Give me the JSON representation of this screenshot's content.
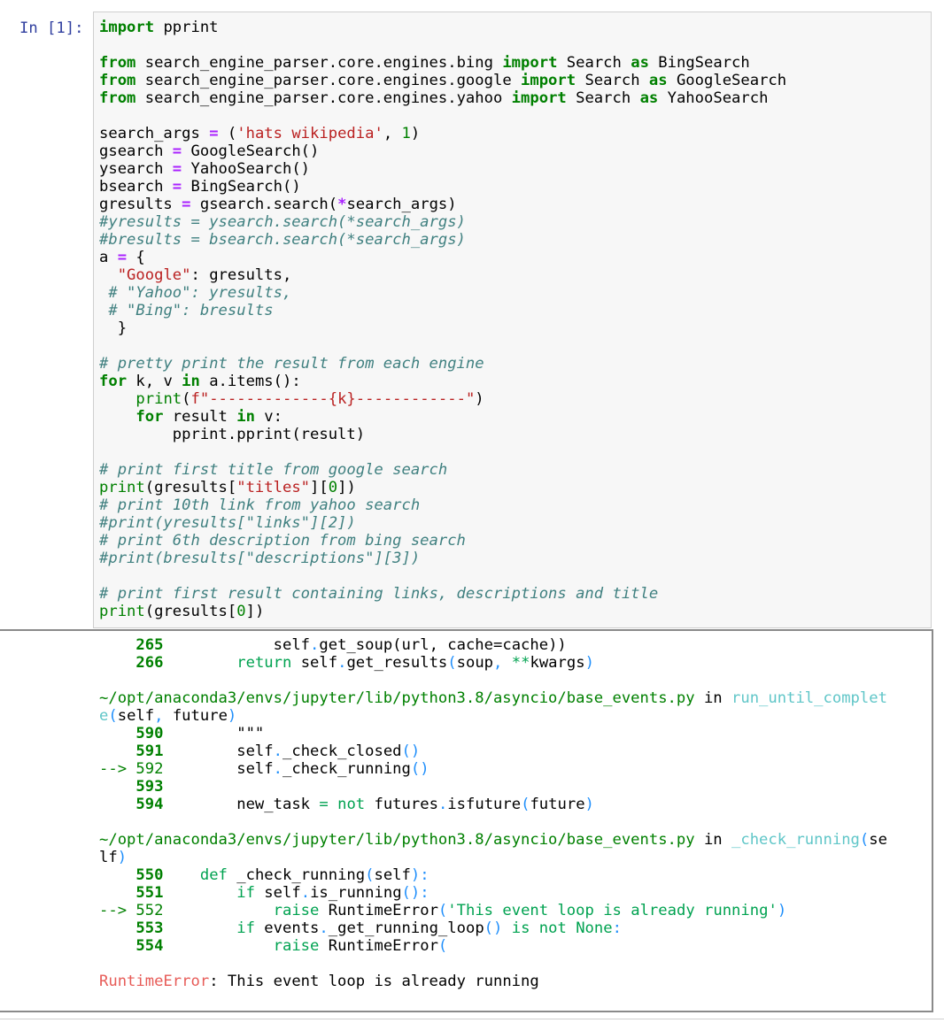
{
  "cell": {
    "prompt": "In [1]:",
    "code": [
      [
        [
          "import",
          "kw"
        ],
        [
          " pprint",
          ""
        ]
      ],
      [],
      [
        [
          "from",
          "kw"
        ],
        [
          " search_engine_parser.core.engines.bing ",
          ""
        ],
        [
          "import",
          "kw"
        ],
        [
          " Search ",
          ""
        ],
        [
          "as",
          "kw"
        ],
        [
          " BingSearch",
          ""
        ]
      ],
      [
        [
          "from",
          "kw"
        ],
        [
          " search_engine_parser.core.engines.google ",
          ""
        ],
        [
          "import",
          "kw"
        ],
        [
          " Search ",
          ""
        ],
        [
          "as",
          "kw"
        ],
        [
          " GoogleSearch",
          ""
        ]
      ],
      [
        [
          "from",
          "kw"
        ],
        [
          " search_engine_parser.core.engines.yahoo ",
          ""
        ],
        [
          "import",
          "kw"
        ],
        [
          " Search ",
          ""
        ],
        [
          "as",
          "kw"
        ],
        [
          " YahooSearch",
          ""
        ]
      ],
      [],
      [
        [
          "search_args ",
          ""
        ],
        [
          "=",
          "op"
        ],
        [
          " (",
          ""
        ],
        [
          "'hats wikipedia'",
          "str"
        ],
        [
          ", ",
          ""
        ],
        [
          "1",
          "num"
        ],
        [
          ")",
          ""
        ]
      ],
      [
        [
          "gsearch ",
          ""
        ],
        [
          "=",
          "op"
        ],
        [
          " GoogleSearch()",
          ""
        ]
      ],
      [
        [
          "ysearch ",
          ""
        ],
        [
          "=",
          "op"
        ],
        [
          " YahooSearch()",
          ""
        ]
      ],
      [
        [
          "bsearch ",
          ""
        ],
        [
          "=",
          "op"
        ],
        [
          " BingSearch()",
          ""
        ]
      ],
      [
        [
          "gresults ",
          ""
        ],
        [
          "=",
          "op"
        ],
        [
          " gsearch.search(",
          ""
        ],
        [
          "*",
          "op"
        ],
        [
          "search_args)",
          ""
        ]
      ],
      [
        [
          "#yresults = ysearch.search(*search_args)",
          "cm"
        ]
      ],
      [
        [
          "#bresults = bsearch.search(*search_args)",
          "cm"
        ]
      ],
      [
        [
          "a ",
          ""
        ],
        [
          "=",
          "op"
        ],
        [
          " {",
          ""
        ]
      ],
      [
        [
          "  ",
          ""
        ],
        [
          "\"Google\"",
          "str"
        ],
        [
          ": gresults,",
          ""
        ]
      ],
      [
        [
          " ",
          ""
        ],
        [
          "# \"Yahoo\": yresults,",
          "cm"
        ]
      ],
      [
        [
          " ",
          ""
        ],
        [
          "# \"Bing\": bresults",
          "cm"
        ]
      ],
      [
        [
          "  }",
          ""
        ]
      ],
      [],
      [
        [
          "# pretty print the result from each engine",
          "cm"
        ]
      ],
      [
        [
          "for",
          "kw"
        ],
        [
          " k, v ",
          ""
        ],
        [
          "in",
          "kw"
        ],
        [
          " a",
          ""
        ],
        [
          ".",
          ""
        ],
        [
          "items():",
          ""
        ]
      ],
      [
        [
          "    ",
          ""
        ],
        [
          "print",
          "blt"
        ],
        [
          "(",
          ""
        ],
        [
          "f\"-------------{k}------------\"",
          "str"
        ],
        [
          ")",
          ""
        ]
      ],
      [
        [
          "    ",
          ""
        ],
        [
          "for",
          "kw"
        ],
        [
          " result ",
          ""
        ],
        [
          "in",
          "kw"
        ],
        [
          " v:",
          ""
        ]
      ],
      [
        [
          "        pprint",
          ""
        ],
        [
          ".",
          ""
        ],
        [
          "pprint(result)",
          ""
        ]
      ],
      [],
      [
        [
          "# print first title from google search",
          "cm"
        ]
      ],
      [
        [
          "print",
          "blt"
        ],
        [
          "(gresults[",
          ""
        ],
        [
          "\"titles\"",
          "str"
        ],
        [
          "][",
          ""
        ],
        [
          "0",
          "num"
        ],
        [
          "])",
          ""
        ]
      ],
      [
        [
          "# print 10th link from yahoo search",
          "cm"
        ]
      ],
      [
        [
          "#print(yresults[\"links\"][2])",
          "cm"
        ]
      ],
      [
        [
          "# print 6th description from bing search",
          "cm"
        ]
      ],
      [
        [
          "#print(bresults[\"descriptions\"][3])",
          "cm"
        ]
      ],
      [],
      [
        [
          "# print first result containing links, descriptions and title",
          "cm"
        ]
      ],
      [
        [
          "print",
          "blt"
        ],
        [
          "(gresults[",
          ""
        ],
        [
          "0",
          "num"
        ],
        [
          "])",
          ""
        ]
      ]
    ]
  },
  "output": {
    "lines": [
      [
        [
          "    ",
          ""
        ],
        [
          "265",
          "ln"
        ],
        [
          "            self",
          ""
        ],
        [
          ".",
          "cy"
        ],
        [
          "get_soup(url, cache=cache))",
          ""
        ]
      ],
      [
        [
          "    ",
          ""
        ],
        [
          "266",
          "ln"
        ],
        [
          "        ",
          ""
        ],
        [
          "return",
          "g"
        ],
        [
          " self",
          ""
        ],
        [
          ".",
          "cy"
        ],
        [
          "get_results",
          ""
        ],
        [
          "(",
          "cy"
        ],
        [
          "soup",
          ""
        ],
        [
          ",",
          "cy"
        ],
        [
          " ",
          ""
        ],
        [
          "**",
          "g"
        ],
        [
          "kwargs",
          ""
        ],
        [
          ")",
          "cy"
        ]
      ],
      [],
      [
        [
          "~/opt/anaconda3/envs/jupyter/lib/python3.8/asyncio/base_events.py",
          "fp"
        ],
        [
          " in ",
          ""
        ],
        [
          "run_until_complet",
          "fn"
        ]
      ],
      [
        [
          "e",
          "fn"
        ],
        [
          "(",
          "cy"
        ],
        [
          "self",
          ""
        ],
        [
          ",",
          "cy"
        ],
        [
          " future",
          ""
        ],
        [
          ")",
          "cy"
        ]
      ],
      [
        [
          "    ",
          ""
        ],
        [
          "590",
          "ln"
        ],
        [
          "        \"\"\"",
          ""
        ]
      ],
      [
        [
          "    ",
          ""
        ],
        [
          "591",
          "ln"
        ],
        [
          "        self",
          ""
        ],
        [
          ".",
          "cy"
        ],
        [
          "_check_closed",
          ""
        ],
        [
          "()",
          "cy"
        ]
      ],
      [
        [
          "--> ",
          "arrow"
        ],
        [
          "592",
          "arrow"
        ],
        [
          "        self",
          ""
        ],
        [
          ".",
          "cy"
        ],
        [
          "_check_running",
          ""
        ],
        [
          "()",
          "cy"
        ]
      ],
      [
        [
          "    ",
          ""
        ],
        [
          "593",
          "ln"
        ]
      ],
      [
        [
          "    ",
          ""
        ],
        [
          "594",
          "ln"
        ],
        [
          "        new_task ",
          ""
        ],
        [
          "=",
          "g"
        ],
        [
          " ",
          ""
        ],
        [
          "not",
          "g"
        ],
        [
          " futures",
          ""
        ],
        [
          ".",
          "cy"
        ],
        [
          "isfuture",
          ""
        ],
        [
          "(",
          "cy"
        ],
        [
          "future",
          ""
        ],
        [
          ")",
          "cy"
        ]
      ],
      [],
      [
        [
          "~/opt/anaconda3/envs/jupyter/lib/python3.8/asyncio/base_events.py",
          "fp"
        ],
        [
          " in ",
          ""
        ],
        [
          "_check_running",
          "fn"
        ],
        [
          "(",
          "cy"
        ],
        [
          "se",
          ""
        ]
      ],
      [
        [
          "lf",
          ""
        ],
        [
          ")",
          "cy"
        ]
      ],
      [
        [
          "    ",
          ""
        ],
        [
          "550",
          "ln"
        ],
        [
          "    ",
          ""
        ],
        [
          "def",
          "g"
        ],
        [
          " _check_running",
          ""
        ],
        [
          "(",
          "cy"
        ],
        [
          "self",
          ""
        ],
        [
          "):",
          "cy"
        ]
      ],
      [
        [
          "    ",
          ""
        ],
        [
          "551",
          "ln"
        ],
        [
          "        ",
          ""
        ],
        [
          "if",
          "g"
        ],
        [
          " self",
          ""
        ],
        [
          ".",
          "cy"
        ],
        [
          "is_running",
          ""
        ],
        [
          "():",
          "cy"
        ]
      ],
      [
        [
          "--> ",
          "arrow"
        ],
        [
          "552",
          "arrow"
        ],
        [
          "            ",
          ""
        ],
        [
          "raise",
          "g"
        ],
        [
          " RuntimeError",
          ""
        ],
        [
          "(",
          "cy"
        ],
        [
          "'This event loop is already running'",
          "g"
        ],
        [
          ")",
          "cy"
        ]
      ],
      [
        [
          "    ",
          ""
        ],
        [
          "553",
          "ln"
        ],
        [
          "        ",
          ""
        ],
        [
          "if",
          "g"
        ],
        [
          " events",
          ""
        ],
        [
          ".",
          "cy"
        ],
        [
          "_get_running_loop",
          ""
        ],
        [
          "()",
          "cy"
        ],
        [
          " ",
          ""
        ],
        [
          "is",
          "g"
        ],
        [
          " ",
          ""
        ],
        [
          "not",
          "g"
        ],
        [
          " ",
          ""
        ],
        [
          "None",
          "g"
        ],
        [
          ":",
          "cy"
        ]
      ],
      [
        [
          "    ",
          ""
        ],
        [
          "554",
          "ln"
        ],
        [
          "            ",
          ""
        ],
        [
          "raise",
          "g"
        ],
        [
          " RuntimeError",
          ""
        ],
        [
          "(",
          "cy"
        ]
      ],
      [],
      [
        [
          "RuntimeError",
          "err"
        ],
        [
          ": This event loop is already running",
          ""
        ]
      ]
    ]
  }
}
